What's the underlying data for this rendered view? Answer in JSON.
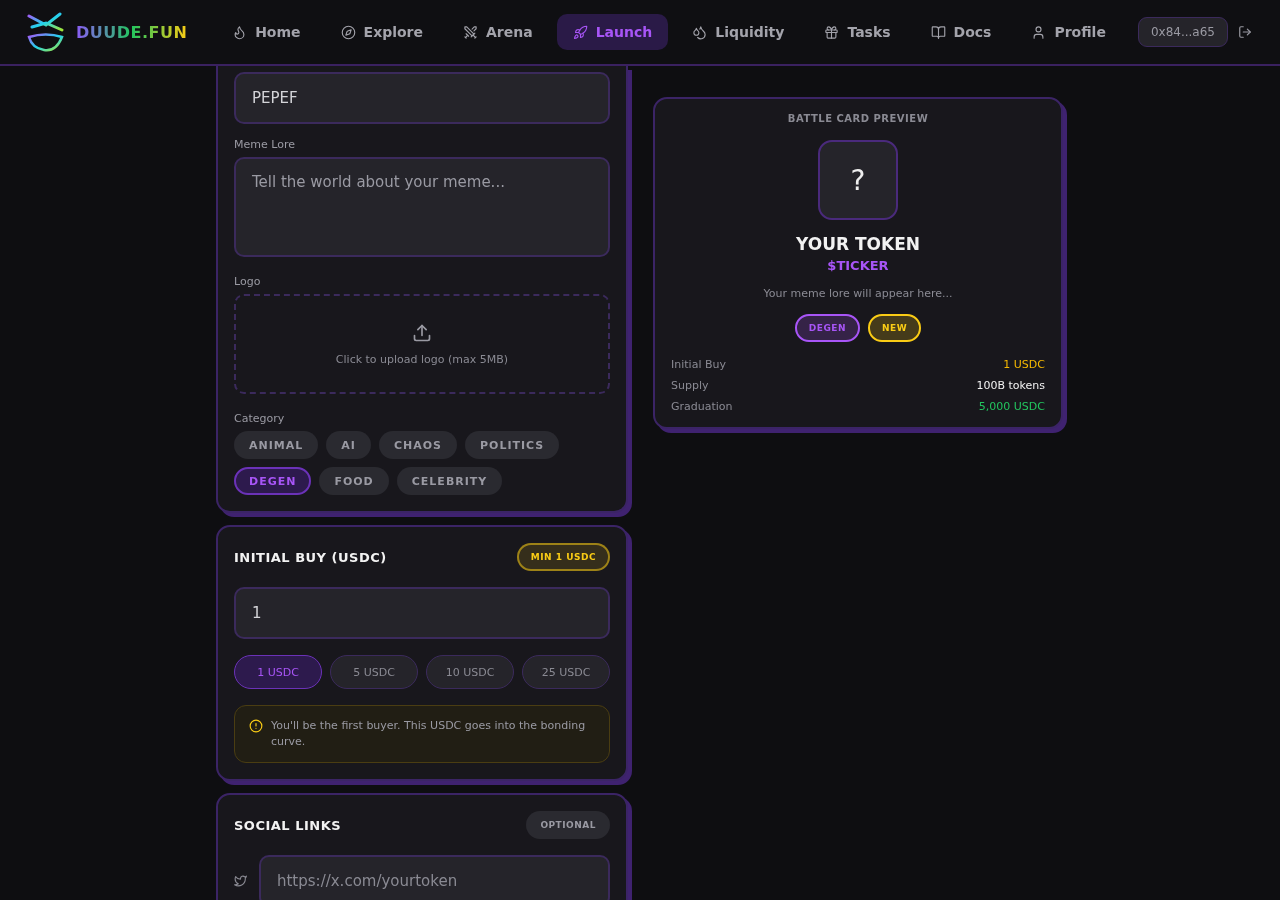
{
  "header": {
    "logo_text": "DUUDE.FUN",
    "nav": [
      {
        "label": "Home",
        "selected": false
      },
      {
        "label": "Explore",
        "selected": false
      },
      {
        "label": "Arena",
        "selected": false
      },
      {
        "label": "Launch",
        "selected": true
      },
      {
        "label": "Liquidity",
        "selected": false
      },
      {
        "label": "Tasks",
        "selected": false
      },
      {
        "label": "Docs",
        "selected": false
      },
      {
        "label": "Profile",
        "selected": false
      }
    ],
    "wallet": "0x84...a65"
  },
  "token_form": {
    "ticker_value": "PEPEF",
    "lore_label": "Meme Lore",
    "lore_placeholder": "Tell the world about your meme...",
    "logo_label": "Logo",
    "upload_text": "Click to upload logo (max 5MB)",
    "category_label": "Category",
    "categories": [
      {
        "label": "ANIMAL",
        "selected": false
      },
      {
        "label": "AI",
        "selected": false
      },
      {
        "label": "CHAOS",
        "selected": false
      },
      {
        "label": "POLITICS",
        "selected": false
      },
      {
        "label": "DEGEN",
        "selected": true
      },
      {
        "label": "FOOD",
        "selected": false
      },
      {
        "label": "CELEBRITY",
        "selected": false
      }
    ]
  },
  "initial_buy": {
    "title": "INITIAL BUY (USDC)",
    "badge": "MIN 1 USDC",
    "value": "1",
    "presets": [
      {
        "label": "1 USDC",
        "selected": true
      },
      {
        "label": "5 USDC",
        "selected": false
      },
      {
        "label": "10 USDC",
        "selected": false
      },
      {
        "label": "25 USDC",
        "selected": false
      }
    ],
    "notice": "You'll be the first buyer. This USDC goes into the bonding curve."
  },
  "social_links": {
    "title": "SOCIAL LINKS",
    "badge": "OPTIONAL",
    "fields": [
      {
        "placeholder": "https://x.com/yourtoken"
      }
    ]
  },
  "preview": {
    "title": "BATTLE CARD PREVIEW",
    "logo_placeholder": "?",
    "name": "YOUR TOKEN",
    "ticker": "$TICKER",
    "lore": "Your meme lore will appear here...",
    "tags": [
      {
        "label": "DEGEN",
        "color": "#a855f7"
      },
      {
        "label": "NEW",
        "color": "#facc15"
      }
    ],
    "stats": [
      {
        "label": "Initial Buy",
        "value": "1 USDC",
        "color": "#f5b800"
      },
      {
        "label": "Supply",
        "value": "100B tokens",
        "color": "#f2f2f2"
      },
      {
        "label": "Graduation",
        "value": "5,000 USDC",
        "color": "#22c55e"
      }
    ]
  }
}
